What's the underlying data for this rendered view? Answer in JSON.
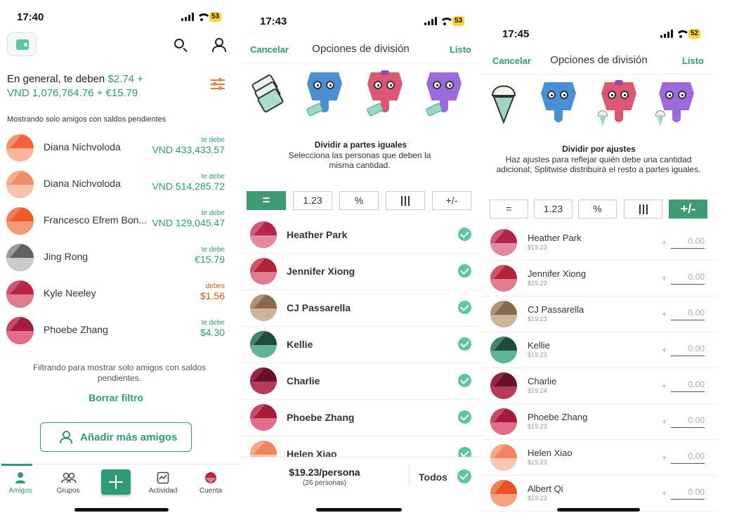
{
  "colors": {
    "accent": "#2f9a77",
    "owes_you": "#2f9a77",
    "you_owe": "#d2561b",
    "check": "#5bc5a7",
    "battery": "#f6d33b"
  },
  "panel1": {
    "status": {
      "time": "17:40",
      "battery": "53"
    },
    "summary": {
      "prefix": "En general, te deben ",
      "amount1": "$2.74 +",
      "amount2": "VND 1,076,764.76 + €15.79"
    },
    "showing_note": "Mostrando solo amigos con saldos pendientes",
    "friends": [
      {
        "name": "Diana Nichvoloda",
        "label": "te debe",
        "amount": "VND 433,433.57",
        "status": "owes_you",
        "avatar": [
          "#f2623c",
          "#f7b69b"
        ]
      },
      {
        "name": "Diana Nichvoloda",
        "label": "te debe",
        "amount": "VND 514,285.72",
        "status": "owes_you",
        "avatar": [
          "#f08c68",
          "#f6c4ad"
        ]
      },
      {
        "name": "Francesco Efrem Bon...",
        "label": "te debe",
        "amount": "VND 129,045.47",
        "status": "owes_you",
        "avatar": [
          "#ec5b2e",
          "#f49a74"
        ]
      },
      {
        "name": "Jing Rong",
        "label": "te debe",
        "amount": "€15.79",
        "status": "owes_you",
        "avatar": [
          "#5f6165",
          "#c9cacc"
        ]
      },
      {
        "name": "Kyle Neeley",
        "label": "debes",
        "amount": "$1.56",
        "status": "you_owe",
        "avatar": [
          "#b72645",
          "#e17b92"
        ]
      },
      {
        "name": "Phoebe Zhang",
        "label": "te debe",
        "amount": "$4.30",
        "status": "owes_you",
        "avatar": [
          "#a51d3c",
          "#e36d88"
        ]
      }
    ],
    "filter_note": "Filtrando para mostrar solo amigos con saldos pendientes.",
    "clear_filter": "Borrar filtro",
    "add_friends": "Añadir más amigos",
    "tabs": [
      "Amigos",
      "Grupos",
      "Actividad",
      "Cuenta"
    ]
  },
  "panel2": {
    "status": {
      "time": "17:43",
      "battery": "53"
    },
    "cancel": "Cancelar",
    "title": "Opciones de división",
    "done": "Listo",
    "mode_title": "Dividir a partes iguales",
    "mode_desc": "Selecciona las personas que deben la misma cantidad.",
    "segments": [
      "=",
      "1.23",
      "%",
      "shares-icon",
      "+/-"
    ],
    "active_segment": 0,
    "people": [
      {
        "name": "Heather Park",
        "avatar": [
          "#b3244a",
          "#e38aa0"
        ]
      },
      {
        "name": "Jennifer Xiong",
        "avatar": [
          "#b3233a",
          "#e07c8f"
        ]
      },
      {
        "name": "CJ Passarella",
        "avatar": [
          "#8a6a4c",
          "#cdb59a"
        ]
      },
      {
        "name": "Kellie",
        "avatar": [
          "#1f4c3b",
          "#5fb596"
        ]
      },
      {
        "name": "Charlie",
        "avatar": [
          "#6a1029",
          "#b73a5b"
        ]
      },
      {
        "name": "Phoebe Zhang",
        "avatar": [
          "#a51d3c",
          "#e36d88"
        ]
      },
      {
        "name": "Helen Xiao",
        "avatar": [
          "#f0845d",
          "#f8c7b1"
        ]
      }
    ],
    "per_person": "$19.23/persona",
    "count": "(26 personas)",
    "all": "Todos"
  },
  "panel3": {
    "status": {
      "time": "17:45",
      "battery": "52"
    },
    "cancel": "Cancelar",
    "title": "Opciones de división",
    "done": "Listo",
    "mode_title": "Dividir por ajustes",
    "mode_desc": "Haz ajustes para reflejar quién debe una cantidad adicional; Splitwise distribuirá el resto a partes iguales.",
    "segments": [
      "=",
      "1.23",
      "%",
      "shares-icon",
      "+/-"
    ],
    "active_segment": 4,
    "people": [
      {
        "name": "Heather Park",
        "share": "$19.23",
        "adj": "0.00",
        "avatar": [
          "#b3244a",
          "#e38aa0"
        ]
      },
      {
        "name": "Jennifer Xiong",
        "share": "$19.23",
        "adj": "0.00",
        "avatar": [
          "#b3233a",
          "#e07c8f"
        ]
      },
      {
        "name": "CJ Passarella",
        "share": "$19.23",
        "adj": "0.00",
        "avatar": [
          "#8a6a4c",
          "#cdb59a"
        ]
      },
      {
        "name": "Kellie",
        "share": "$19.23",
        "adj": "0.00",
        "avatar": [
          "#1f4c3b",
          "#5fb596"
        ]
      },
      {
        "name": "Charlie",
        "share": "$19.24",
        "adj": "0.00",
        "avatar": [
          "#6a1029",
          "#b73a5b"
        ]
      },
      {
        "name": "Phoebe Zhang",
        "share": "$19.23",
        "adj": "0.00",
        "avatar": [
          "#a51d3c",
          "#e36d88"
        ]
      },
      {
        "name": "Helen Xiao",
        "share": "$19.23",
        "adj": "0.00",
        "avatar": [
          "#f0845d",
          "#f8c7b1"
        ]
      },
      {
        "name": "Albert Qi",
        "share": "$19.23",
        "adj": "0.00",
        "avatar": [
          "#e8512a",
          "#f5a07e"
        ]
      }
    ]
  }
}
